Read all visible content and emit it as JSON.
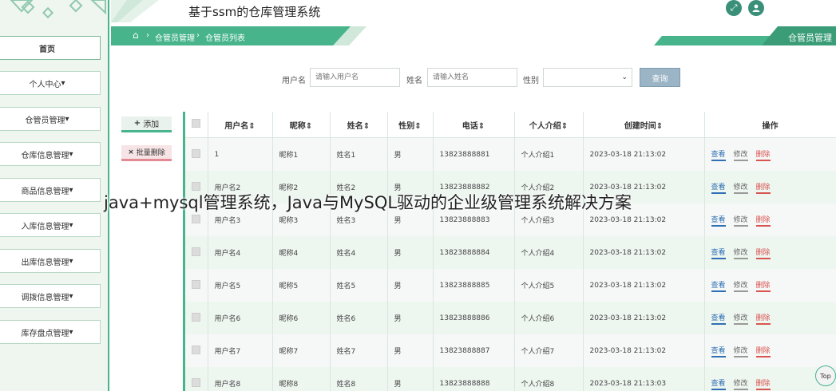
{
  "header": {
    "app_title": "基于ssm的仓库管理系统",
    "role_label": "仓管员管理"
  },
  "breadcrumb": {
    "items": [
      "仓管员管理",
      "仓管员列表"
    ]
  },
  "sidebar": {
    "items": [
      {
        "label": "首页"
      },
      {
        "label": "个人中心"
      },
      {
        "label": "仓管员管理"
      },
      {
        "label": "仓库信息管理"
      },
      {
        "label": "商品信息管理"
      },
      {
        "label": "入库信息管理"
      },
      {
        "label": "出库信息管理"
      },
      {
        "label": "调拨信息管理"
      },
      {
        "label": "库存盘点管理"
      }
    ]
  },
  "filters": {
    "username_label": "用户名",
    "username_placeholder": "请输入用户名",
    "name_label": "姓名",
    "name_placeholder": "请输入姓名",
    "gender_label": "性别",
    "gender_value": "",
    "query_button": "查询"
  },
  "actions": {
    "add": "添加",
    "batch_delete": "批量删除"
  },
  "table": {
    "columns": [
      "用户名",
      "昵称",
      "姓名",
      "性别",
      "电话",
      "个人介绍",
      "创建时间",
      "操作"
    ],
    "rows": [
      {
        "username": "1",
        "nickname": "昵称1",
        "name": "姓名1",
        "gender": "男",
        "phone": "13823888881",
        "intro": "个人介绍1",
        "created": "2023-03-18 21:13:02"
      },
      {
        "username": "用户名2",
        "nickname": "昵称2",
        "name": "姓名2",
        "gender": "男",
        "phone": "13823888882",
        "intro": "个人介绍2",
        "created": "2023-03-18 21:13:02"
      },
      {
        "username": "用户名3",
        "nickname": "昵称3",
        "name": "姓名3",
        "gender": "男",
        "phone": "13823888883",
        "intro": "个人介绍3",
        "created": "2023-03-18 21:13:02"
      },
      {
        "username": "用户名4",
        "nickname": "昵称4",
        "name": "姓名4",
        "gender": "男",
        "phone": "13823888884",
        "intro": "个人介绍4",
        "created": "2023-03-18 21:13:02"
      },
      {
        "username": "用户名5",
        "nickname": "昵称5",
        "name": "姓名5",
        "gender": "男",
        "phone": "13823888885",
        "intro": "个人介绍5",
        "created": "2023-03-18 21:13:02"
      },
      {
        "username": "用户名6",
        "nickname": "昵称6",
        "name": "姓名6",
        "gender": "男",
        "phone": "13823888886",
        "intro": "个人介绍6",
        "created": "2023-03-18 21:13:02"
      },
      {
        "username": "用户名7",
        "nickname": "昵称7",
        "name": "姓名7",
        "gender": "男",
        "phone": "13823888887",
        "intro": "个人介绍7",
        "created": "2023-03-18 21:13:02"
      },
      {
        "username": "用户名8",
        "nickname": "昵称8",
        "name": "姓名8",
        "gender": "男",
        "phone": "13823888888",
        "intro": "个人介绍8",
        "created": "2023-03-18 21:13:03"
      }
    ],
    "row_actions": {
      "view": "查看",
      "edit": "修改",
      "delete": "删除"
    }
  },
  "overlay_text": "java+mysql管理系统，Java与MySQL驱动的企业级管理系统解决方案",
  "back_to_top": "Top",
  "colors": {
    "accent": "#47b48c",
    "accent_dark": "#3a8f79",
    "danger": "#d9534f",
    "link": "#2f6fb3"
  }
}
